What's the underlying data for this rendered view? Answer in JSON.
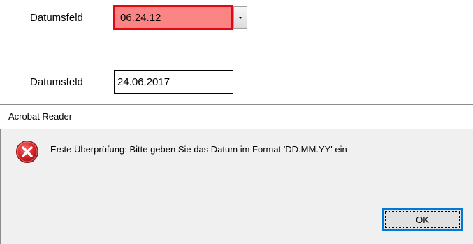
{
  "form": {
    "field1": {
      "label": "Datumsfeld",
      "value": "06.24.12"
    },
    "field2": {
      "label": "Datumsfeld",
      "value": "24.06.2017"
    }
  },
  "dialog": {
    "title": "Acrobat Reader",
    "message": "Erste Überprüfung: Bitte geben Sie das Datum im Format 'DD.MM.YY' ein",
    "ok_label": "OK",
    "icon": "error-icon"
  },
  "colors": {
    "invalid_field_bg": "#fb8585",
    "invalid_field_border": "#e30613",
    "dialog_bg": "#f0f0f0",
    "ok_button_border": "#0078d7",
    "error_icon_red": "#d8262a"
  }
}
